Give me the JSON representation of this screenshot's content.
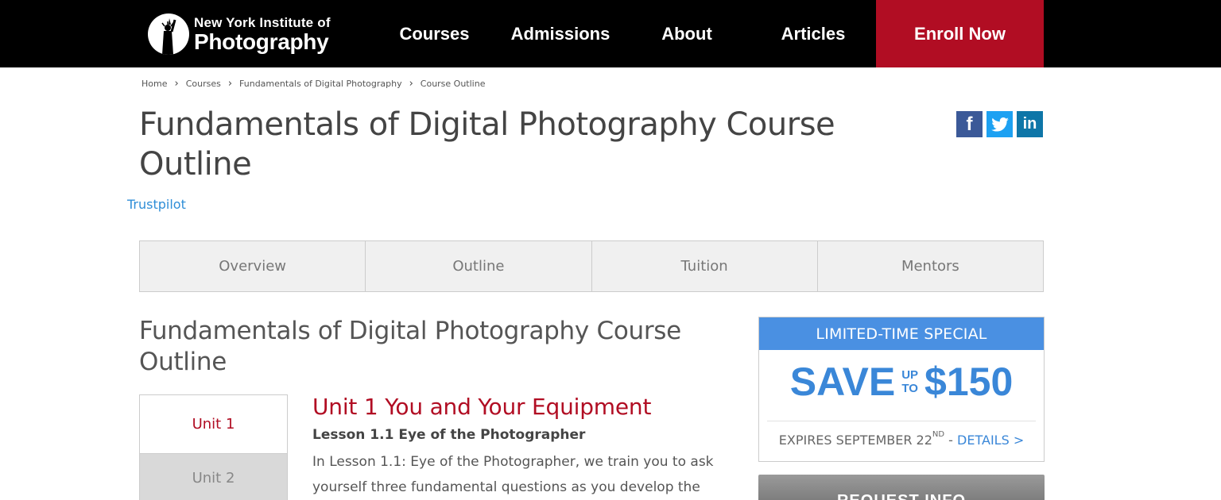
{
  "header": {
    "logo_line1": "New York Institute of",
    "logo_line2": "Photography",
    "nav": {
      "courses": "Courses",
      "admissions": "Admissions",
      "about": "About",
      "articles": "Articles",
      "enroll": "Enroll Now"
    }
  },
  "breadcrumb": [
    "Home",
    "Courses",
    "Fundamentals of Digital Photography",
    "Course Outline"
  ],
  "page_title": "Fundamentals of Digital Photography Course Outline",
  "social": {
    "facebook": "f",
    "twitter_icon": "twitter-bird",
    "linkedin": "in"
  },
  "trustpilot": "Trustpilot",
  "tabs": [
    "Overview",
    "Outline",
    "Tuition",
    "Mentors"
  ],
  "section_title": "Fundamentals of Digital Photography Course Outline",
  "units": {
    "unit1_label": "Unit 1",
    "unit2_label": "Unit 2"
  },
  "content": {
    "unit_heading": "Unit 1 You and Your Equipment",
    "lesson_title": "Lesson 1.1 Eye of the Photographer",
    "lesson_body": "In Lesson 1.1: Eye of the Photographer, we train you to ask yourself three fundamental questions as you develop the"
  },
  "promo": {
    "header": "LIMITED-TIME SPECIAL",
    "save": "SAVE",
    "up": "UP",
    "to": "TO",
    "amount": "$150",
    "expires_prefix": "EXPIRES SEPTEMBER 22",
    "expires_suffix": "ND",
    "expires_sep": " - ",
    "details": "DETAILS >"
  },
  "request_info": "REQUEST INFO",
  "colors": {
    "brand_red": "#b10d23",
    "accent_blue": "#4a90e2",
    "link_blue": "#2f8ed7"
  }
}
